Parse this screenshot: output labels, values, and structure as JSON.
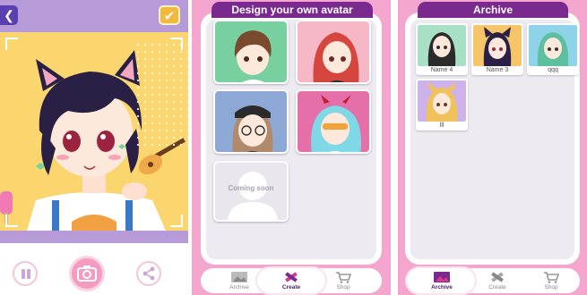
{
  "camera": {
    "back_icon": "chevron-left-icon",
    "confirm_icon": "check-icon",
    "accent": "#b79ad8",
    "photo_bg": "#fbd56d"
  },
  "design": {
    "title": "Design your own avatar",
    "coming_soon": "Coming soon",
    "templates": [
      {
        "bg": "#78cfa0"
      },
      {
        "bg": "#f6b7c7"
      },
      {
        "bg": "#8ea8d6"
      },
      {
        "bg": "#e56fa8"
      }
    ]
  },
  "archive": {
    "title": "Archive",
    "items": [
      {
        "label": "Name 4",
        "bg": "#a8e0c6"
      },
      {
        "label": "Name 3",
        "bg": "#f6c56a"
      },
      {
        "label": "qqq",
        "bg": "#8fd3e8"
      },
      {
        "label": "lll",
        "bg": "#cdb3ea"
      }
    ]
  },
  "nav": {
    "archive": "Archive",
    "create": "Create",
    "shop": "Shop"
  },
  "colors": {
    "panel_pink": "#f4a6cf",
    "title_purple": "#7a2a8e",
    "board_inner": "#eeeaf2"
  }
}
